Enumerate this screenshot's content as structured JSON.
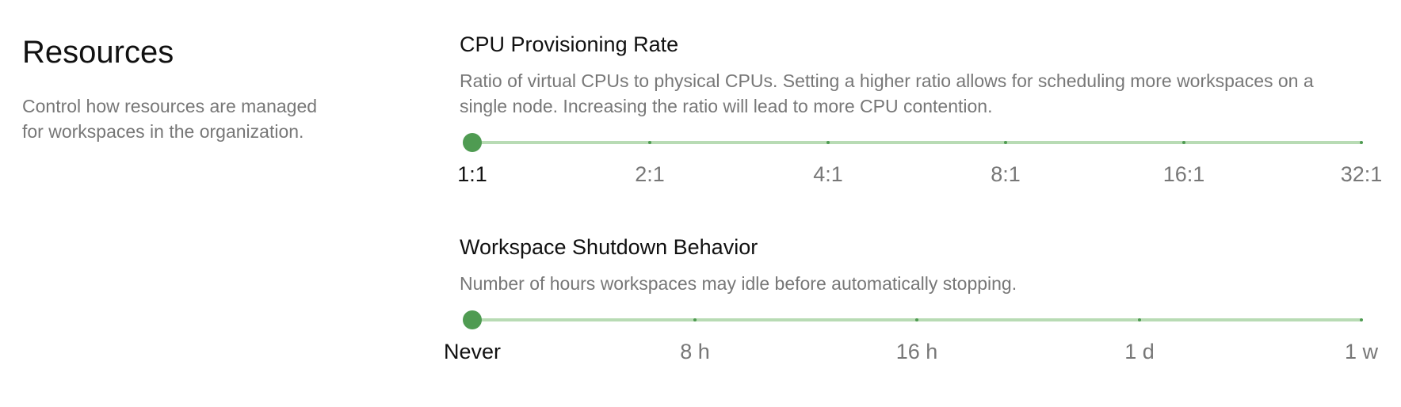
{
  "resources": {
    "title": "Resources",
    "description": "Control how resources are managed for workspaces in the organization."
  },
  "cpu": {
    "title": "CPU Provisioning Rate",
    "description": "Ratio of virtual CPUs to physical CPUs. Setting a higher ratio allows for scheduling more workspaces on a single node. Increasing the ratio will lead to more CPU contention.",
    "ticks": [
      "1:1",
      "2:1",
      "4:1",
      "8:1",
      "16:1",
      "32:1"
    ],
    "selected_index": 0
  },
  "shutdown": {
    "title": "Workspace Shutdown Behavior",
    "description": "Number of hours workspaces may idle before automatically stopping.",
    "ticks": [
      "Never",
      "8 h",
      "16 h",
      "1 d",
      "1 w"
    ],
    "selected_index": 0
  },
  "colors": {
    "accent": "#4f9b52",
    "track": "#b8dbb4",
    "muted_text": "#777777"
  }
}
